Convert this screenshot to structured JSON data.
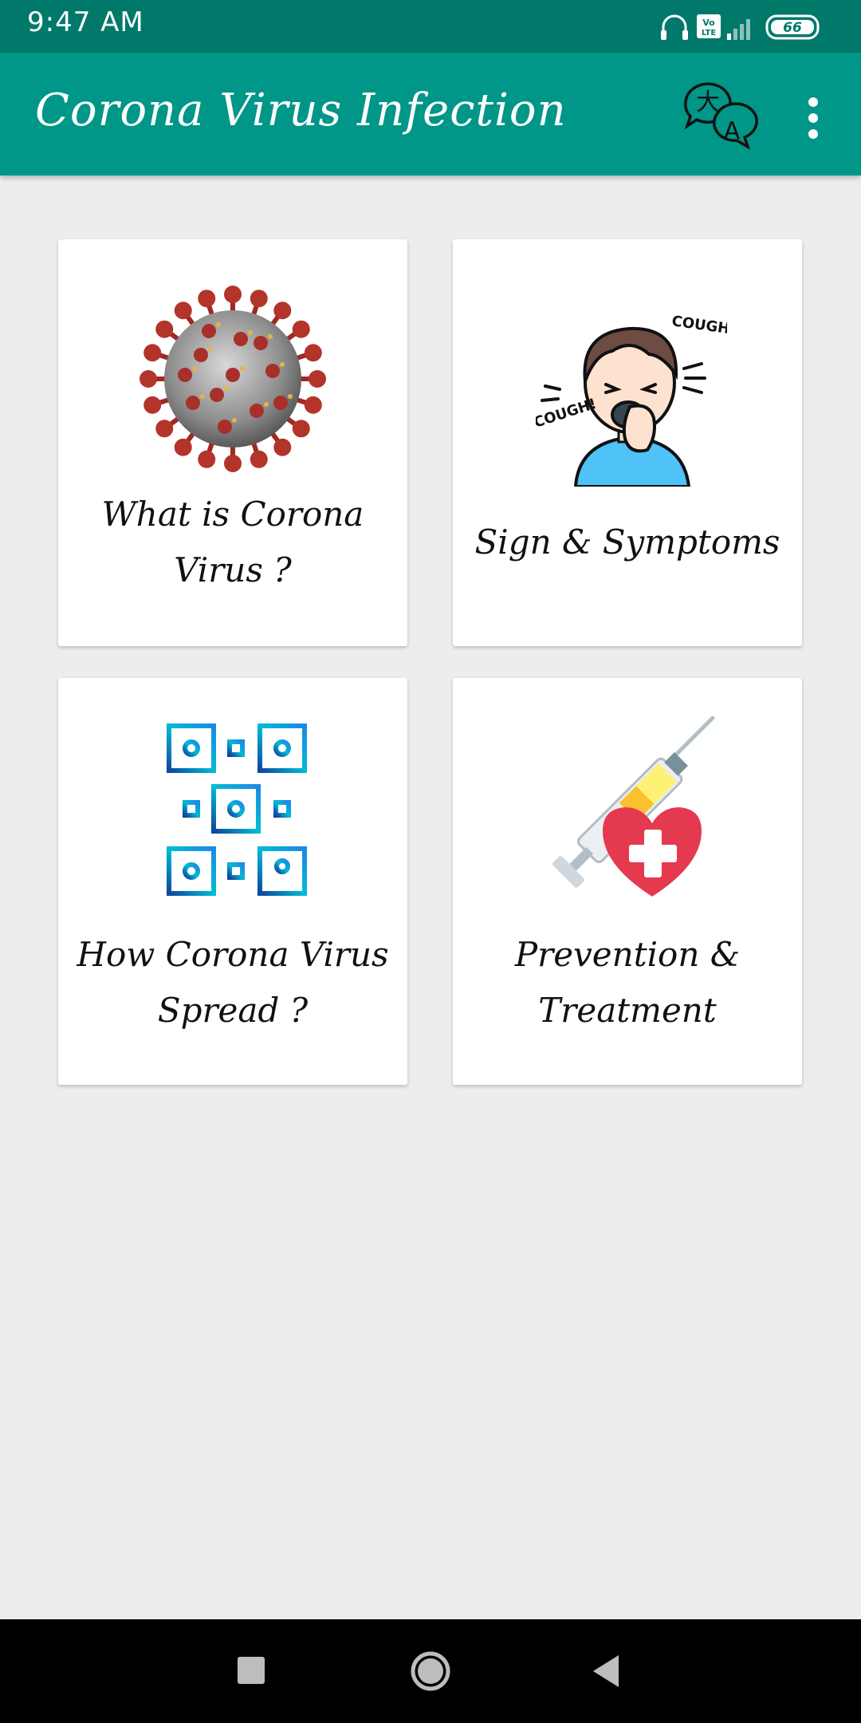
{
  "status": {
    "time": "9:47 AM",
    "battery": "66",
    "network": "Vo LTE"
  },
  "appbar": {
    "title": "Corona Virus Infection",
    "translate_icon": "translate-icon",
    "menu_icon": "more-vertical-icon"
  },
  "cards": [
    {
      "label_lines": [
        "What is Corona",
        "Virus ?"
      ],
      "icon": "coronavirus-icon"
    },
    {
      "label_lines": [
        "Sign & Symptoms"
      ],
      "icon": "coughing-person-icon",
      "cough_text": "COUGH!"
    },
    {
      "label_lines": [
        "How Corona Virus",
        "Spread ?"
      ],
      "icon": "network-spread-icon"
    },
    {
      "label_lines": [
        "Prevention &",
        "Treatment"
      ],
      "icon": "syringe-heart-icon"
    }
  ],
  "colors": {
    "statusbar": "#00796b",
    "appbar": "#009688",
    "background": "#ededed"
  },
  "navbar": {
    "icons": [
      "recent-apps-icon",
      "home-icon",
      "back-icon"
    ]
  }
}
